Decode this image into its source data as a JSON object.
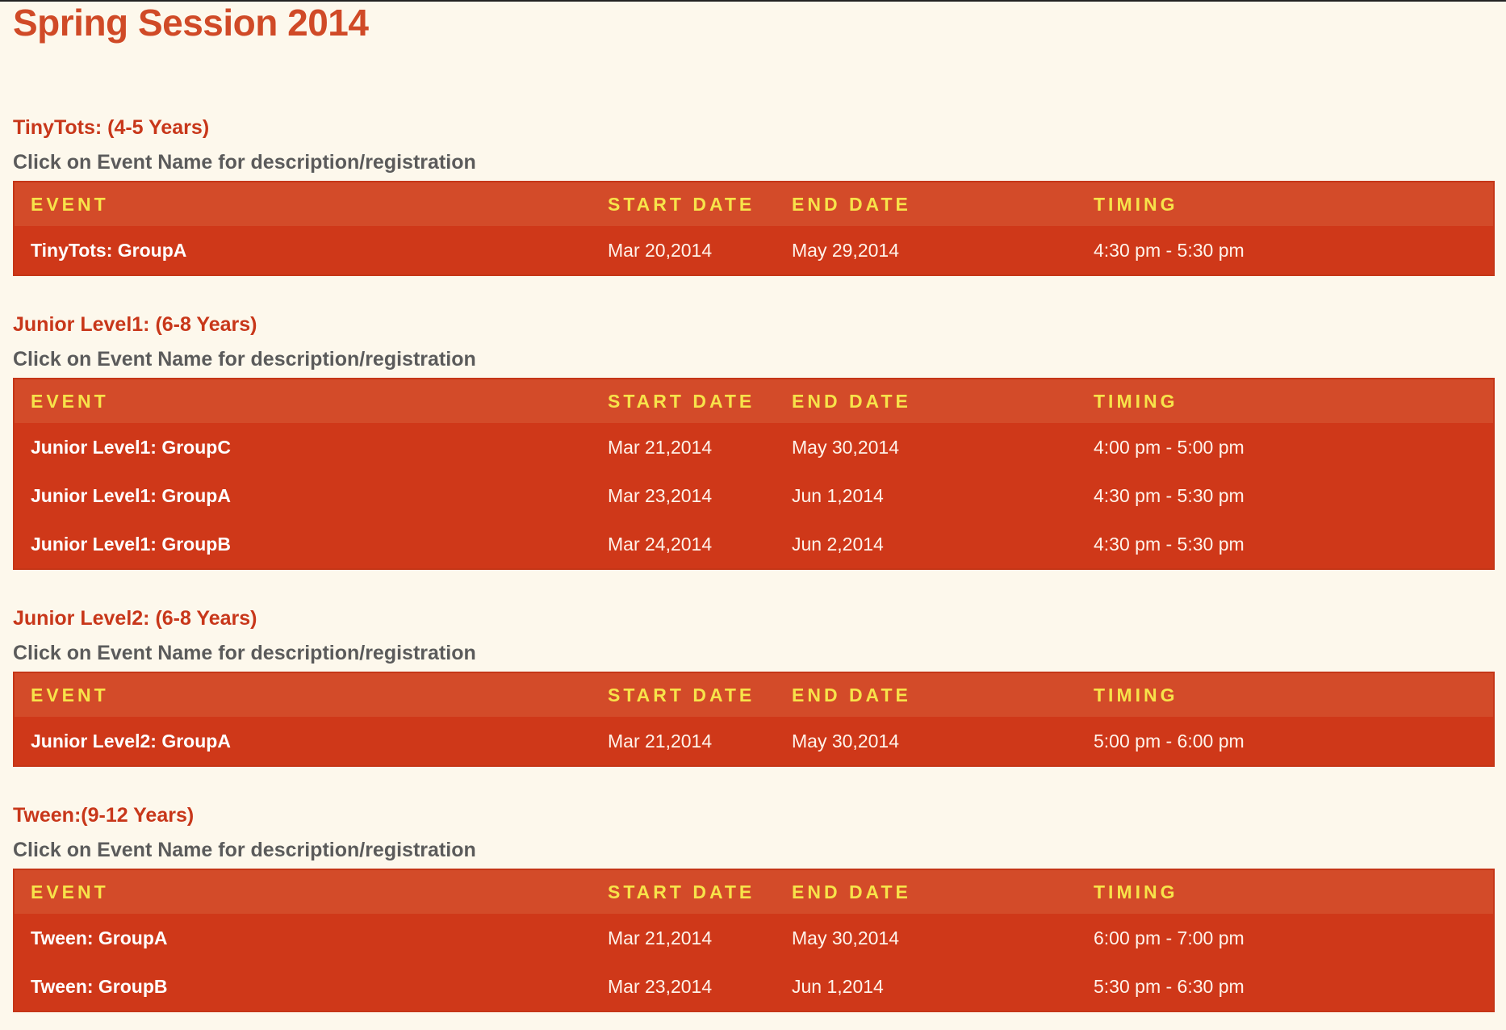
{
  "page": {
    "title": "Spring Session 2014"
  },
  "table_headers": {
    "event": "EVENT",
    "start_date": "START DATE",
    "end_date": "END DATE",
    "timing": "TIMING"
  },
  "sections": [
    {
      "title": "TinyTots: (4-5 Years)",
      "hint": "Click on Event Name for description/registration",
      "rows": [
        {
          "event": "TinyTots: GroupA",
          "start": "Mar 20,2014",
          "end": "May 29,2014",
          "timing": "4:30 pm - 5:30 pm"
        }
      ]
    },
    {
      "title": "Junior Level1: (6-8 Years)",
      "hint": "Click on Event Name for description/registration",
      "rows": [
        {
          "event": "Junior Level1: GroupC",
          "start": "Mar 21,2014",
          "end": "May 30,2014",
          "timing": "4:00 pm - 5:00 pm"
        },
        {
          "event": "Junior Level1: GroupA",
          "start": "Mar 23,2014",
          "end": "Jun 1,2014",
          "timing": "4:30 pm - 5:30 pm"
        },
        {
          "event": "Junior Level1: GroupB",
          "start": "Mar 24,2014",
          "end": "Jun 2,2014",
          "timing": "4:30 pm - 5:30 pm"
        }
      ]
    },
    {
      "title": "Junior Level2: (6-8 Years)",
      "hint": "Click on Event Name for description/registration",
      "rows": [
        {
          "event": "Junior Level2: GroupA",
          "start": "Mar 21,2014",
          "end": "May 30,2014",
          "timing": "5:00 pm - 6:00 pm"
        }
      ]
    },
    {
      "title": "Tween:(9-12 Years)",
      "hint": "Click on Event Name for description/registration",
      "rows": [
        {
          "event": "Tween: GroupA",
          "start": "Mar 21,2014",
          "end": "May 30,2014",
          "timing": "6:00 pm - 7:00 pm"
        },
        {
          "event": "Tween: GroupB",
          "start": "Mar 23,2014",
          "end": "Jun 1,2014",
          "timing": "5:30 pm - 6:30 pm"
        }
      ]
    }
  ],
  "colors": {
    "background": "#fdf8ec",
    "accent": "#d04a27",
    "table_body": "#cf3819",
    "table_header": "#d34b29",
    "header_text": "#f7e34a"
  }
}
